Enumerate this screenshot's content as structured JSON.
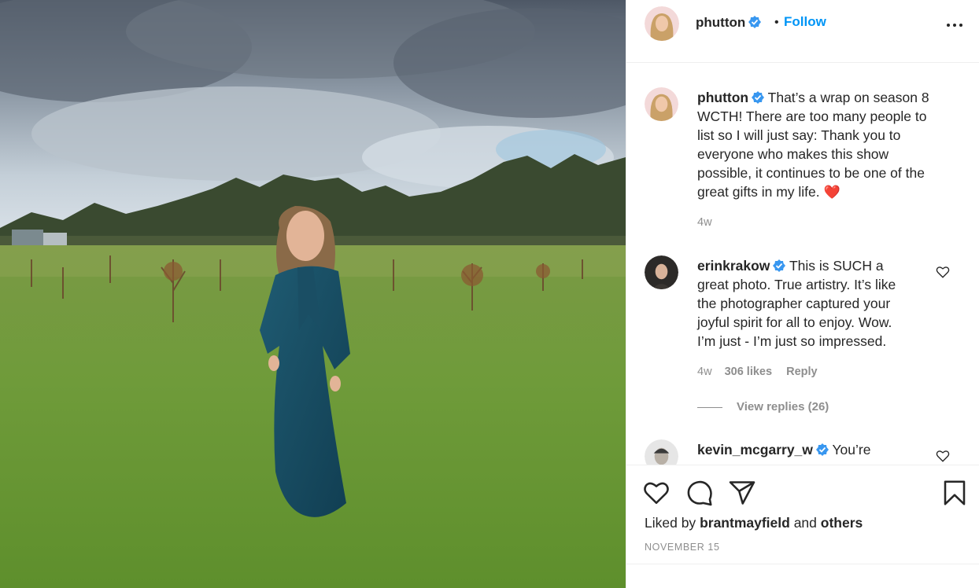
{
  "post": {
    "username": "phutton",
    "follow_label": "Follow",
    "separator": "•",
    "more_icon": "more-horizontal-icon"
  },
  "caption": {
    "username": "phutton",
    "lines": [
      "That’s a wrap on season 8",
      "WCTH! There are too many people to",
      "list so I will just say: Thank you to",
      "everyone who makes this show",
      "possible, it continues to be one of the",
      "great gifts in my life."
    ],
    "emoji": "❤️",
    "age": "4w"
  },
  "comments": [
    {
      "username": "erinkrakow",
      "lines": [
        "This is SUCH a",
        "great photo. True artistry. It’s like",
        "the photographer captured your",
        "joyful spirit for all to enjoy. Wow.",
        "I’m just - I’m just so impressed."
      ],
      "age": "4w",
      "likes": "306 likes",
      "reply_label": "Reply",
      "view_replies": "View replies (26)"
    },
    {
      "username": "kevin_mcgarry_w",
      "lines": [
        "You’re"
      ]
    }
  ],
  "actions": {
    "like_icon": "heart-icon",
    "comment_icon": "comment-icon",
    "share_icon": "share-icon",
    "save_icon": "bookmark-icon",
    "liked_by_prefix": "Liked by",
    "liked_by_user": "brantmayfield",
    "liked_by_and": "and",
    "liked_by_others": "others",
    "date": "NOVEMBER 15"
  },
  "colors": {
    "accent": "#0095f6",
    "verified": "#3897f0",
    "text": "#262626",
    "muted": "#8e8e8e",
    "heart_emoji": "#e0245e"
  }
}
